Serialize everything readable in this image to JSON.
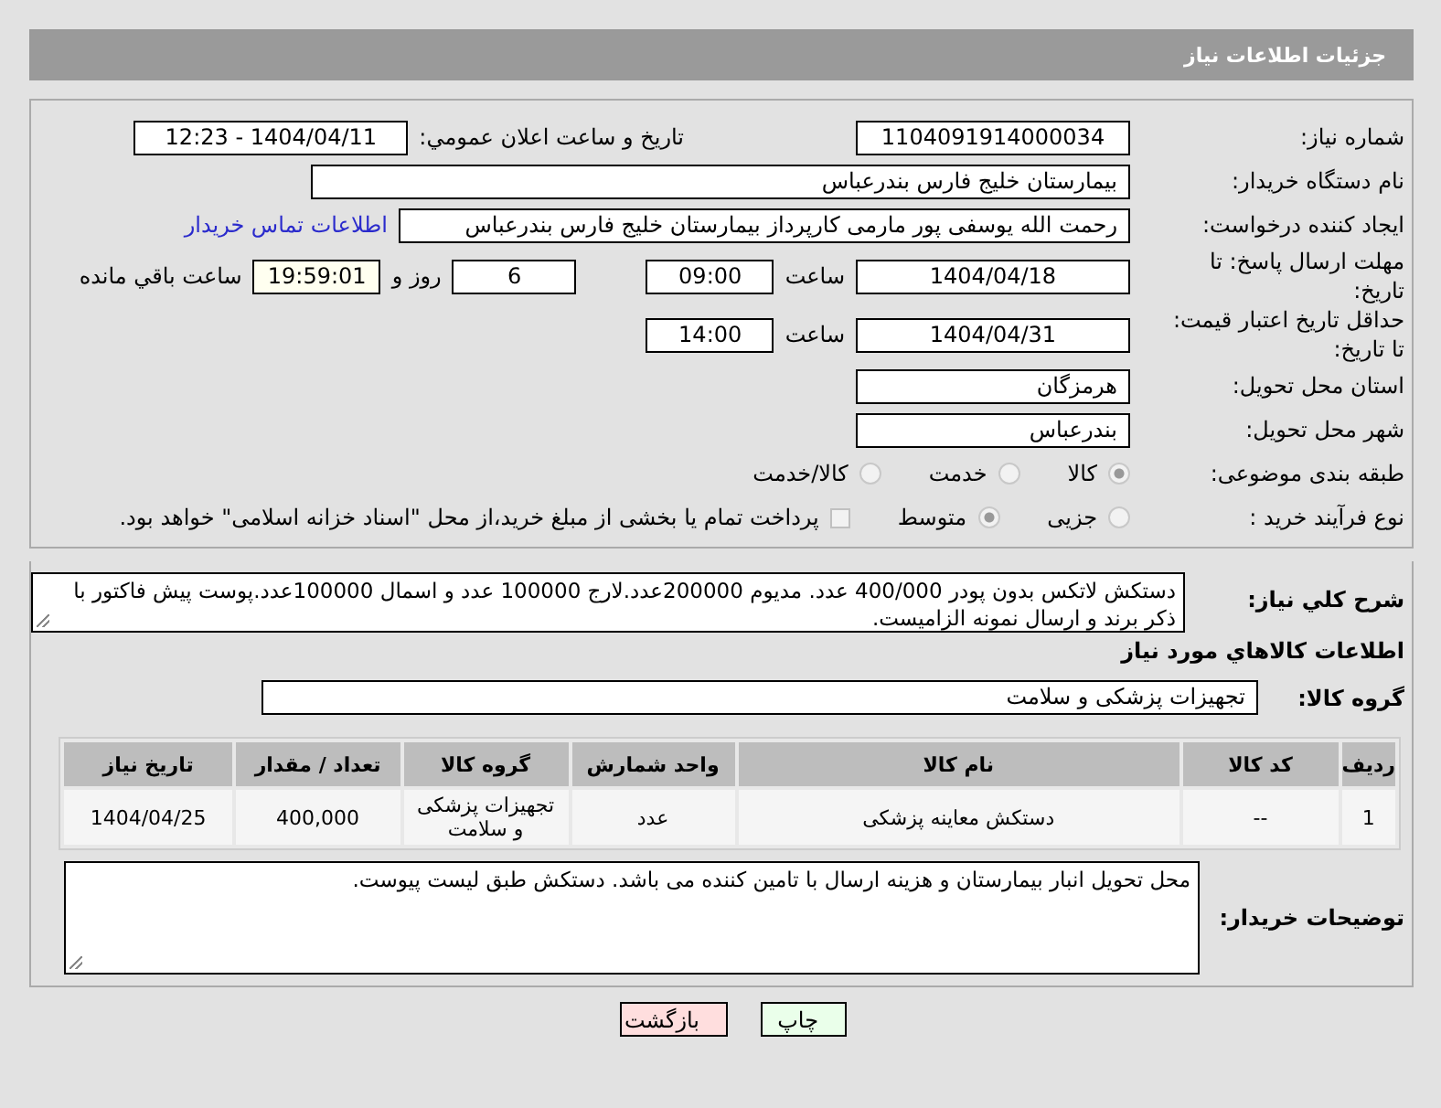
{
  "header": {
    "title": "جزئیات اطلاعات نیاز"
  },
  "need_number": {
    "label": "شماره نیاز:",
    "value": "1104091914000034"
  },
  "announce": {
    "label": "تاریخ و ساعت اعلان عمومي:",
    "value": "1404/04/11 - 12:23"
  },
  "buyer_org": {
    "label": "نام دستگاه خریدار:",
    "value": "بیمارستان خلیج فارس بندرعباس"
  },
  "requester": {
    "label": "ایجاد کننده درخواست:",
    "value": "رحمت الله یوسفی پور مارمی کارپرداز بیمارستان خلیج فارس بندرعباس",
    "link": "اطلاعات تماس خریدار"
  },
  "deadline": {
    "label": "مهلت ارسال پاسخ: تا تاریخ:",
    "date": "1404/04/18",
    "time_label": "ساعت",
    "time": "09:00",
    "days": "6",
    "days_label": "روز و",
    "remaining": "19:59:01",
    "remaining_label": "ساعت باقي مانده"
  },
  "validity": {
    "label": "حداقل تاریخ اعتبار قیمت: تا تاریخ:",
    "date": "1404/04/31",
    "time_label": "ساعت",
    "time": "14:00"
  },
  "province": {
    "label": "استان محل تحویل:",
    "value": "هرمزگان"
  },
  "city": {
    "label": "شهر محل تحویل:",
    "value": "بندرعباس"
  },
  "category": {
    "label": "طبقه بندی موضوعی:",
    "options": [
      {
        "label": "کالا",
        "selected": true
      },
      {
        "label": "خدمت",
        "selected": false
      },
      {
        "label": "کالا/خدمت",
        "selected": false
      }
    ]
  },
  "purchase_type": {
    "label": "نوع فرآیند خرید :",
    "options": [
      {
        "label": "جزیی",
        "selected": false
      },
      {
        "label": "متوسط",
        "selected": true
      }
    ],
    "treasury": {
      "label": "پرداخت تمام یا بخشی از مبلغ خرید،از محل \"اسناد خزانه اسلامی\" خواهد بود.",
      "checked": false
    }
  },
  "description": {
    "label": "شرح کلي نیاز:",
    "value": "دستکش لاتکس بدون پودر 400/000 عدد. مدیوم 200000عدد.لارج 100000 عدد و اسمال 100000عدد.پوست پیش فاکتور با ذکر برند و ارسال نمونه الزامیست."
  },
  "goods_title": "اطلاعات کالاهاي مورد نیاز",
  "goods_group": {
    "label": "گروه کالا:",
    "value": "تجهیزات پزشکی و سلامت"
  },
  "table": {
    "columns": [
      "ردیف",
      "کد کالا",
      "نام کالا",
      "واحد شمارش",
      "گروه کالا",
      "تعداد / مقدار",
      "تاریخ نیاز"
    ],
    "rows": [
      [
        "1",
        "--",
        "دستکش معاینه پزشکی",
        "عدد",
        "تجهیزات پزشکی و سلامت",
        "400,000",
        "1404/04/25"
      ]
    ]
  },
  "buyer_notes": {
    "label": "توضیحات خریدار:",
    "value": "محل تحویل انبار بیمارستان و هزینه ارسال با تامین کننده می باشد. دستکش طبق لیست پیوست."
  },
  "buttons": [
    {
      "label": "چاپ",
      "kind": "print"
    },
    {
      "label": "بازگشت",
      "kind": "back"
    }
  ]
}
